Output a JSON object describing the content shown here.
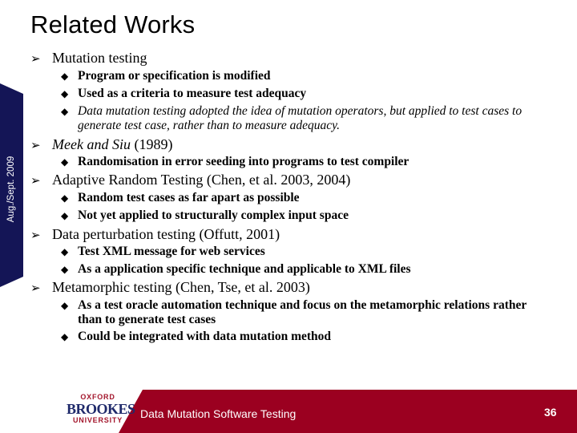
{
  "slide": {
    "title": "Related Works",
    "sidebar_date": "Aug./Sept. 2009",
    "colors": {
      "sidebar": "#141556",
      "footer": "#9b0020",
      "logo_red": "#a3162c",
      "logo_blue": "#1f2a6b"
    },
    "bullet_icon_l1": "arrowhead-icon",
    "bullet_icon_l2": "diamond-icon",
    "items": [
      {
        "heading": "Mutation testing",
        "sub": [
          "Program or specification is modified",
          "Used as a criteria to measure test adequacy",
          "Data mutation testing adopted the idea of mutation operators, but applied to test cases to generate test case, rather than to measure adequacy."
        ]
      },
      {
        "heading_italic": "Meek and Siu",
        "heading_rest": " (1989)",
        "sub": [
          "Randomisation in error seeding into programs to test compiler"
        ]
      },
      {
        "heading": "Adaptive Random Testing (Chen, et al. 2003, 2004)",
        "sub": [
          "Random test cases as far apart as possible",
          "Not yet applied to structurally complex input space"
        ]
      },
      {
        "heading": "Data perturbation testing (Offutt, 2001)",
        "sub": [
          "Test XML message for web services",
          "As a application specific technique and applicable to XML files"
        ]
      },
      {
        "heading": "Metamorphic testing (Chen, Tse, et al. 2003)",
        "sub": [
          "As a test oracle automation technique and focus on the metamorphic relations rather than to generate test cases",
          "Could be integrated with data mutation method"
        ]
      }
    ]
  },
  "footer": {
    "logo": {
      "line1": "OXFORD",
      "line2": "BROOKES",
      "line3": "UNIVERSITY"
    },
    "title": "Data Mutation Software Testing",
    "page_number": "36"
  },
  "glyphs": {
    "arrow": "➢",
    "diamond": "◆"
  }
}
